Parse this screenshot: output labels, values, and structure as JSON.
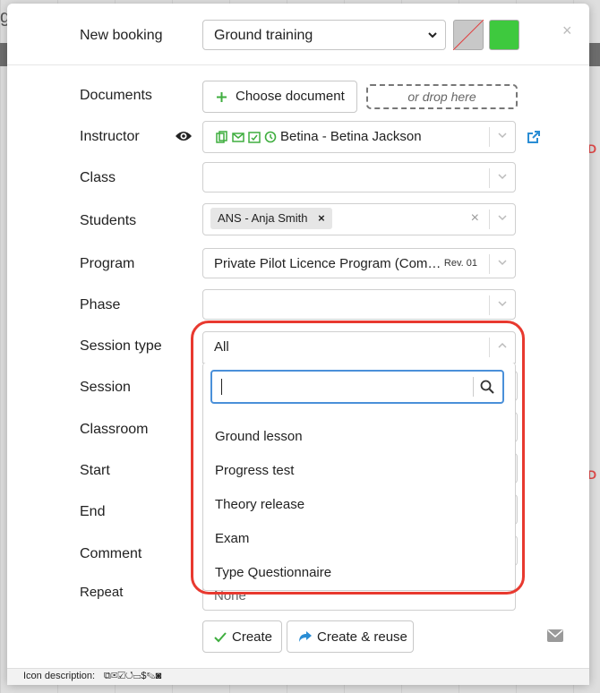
{
  "background": {
    "partial_letter": "g"
  },
  "modal": {
    "title_label": "New booking",
    "booking_type": "Ground training",
    "colors": {
      "swatch_gray": "#c8c8c8",
      "swatch_green": "#3ec93e",
      "accent": "#2a8dd4",
      "highlight": "#e8392f",
      "icon_green": "#3fae3f"
    },
    "close_label": "×"
  },
  "labels": {
    "documents": "Documents",
    "instructor": "Instructor",
    "class": "Class",
    "students": "Students",
    "program": "Program",
    "phase": "Phase",
    "session_type": "Session type",
    "session": "Session",
    "classroom": "Classroom",
    "start": "Start",
    "end": "End",
    "comment": "Comment",
    "repeat": "Repeat"
  },
  "documents": {
    "choose_label": "Choose document",
    "drop_label": "or drop here"
  },
  "instructor": {
    "value": "Betina - Betina Jackson",
    "icons": [
      "copy-icon",
      "mail-icon",
      "calendar-check-icon",
      "history-icon"
    ]
  },
  "students": {
    "tags": [
      {
        "label": "ANS - Anja Smith"
      }
    ]
  },
  "program": {
    "value": "Private Pilot Licence Program (Com…",
    "revision": "Rev. 01"
  },
  "session_type": {
    "value": "All",
    "search_placeholder": "",
    "options": [
      "Ground lesson",
      "Progress test",
      "Theory release",
      "Exam",
      "Type Questionnaire"
    ]
  },
  "repeat": {
    "value": "None"
  },
  "actions": {
    "create_label": "Create",
    "create_reuse_label": "Create & reuse"
  },
  "footer": {
    "icon_description_label": "Icon description:"
  }
}
